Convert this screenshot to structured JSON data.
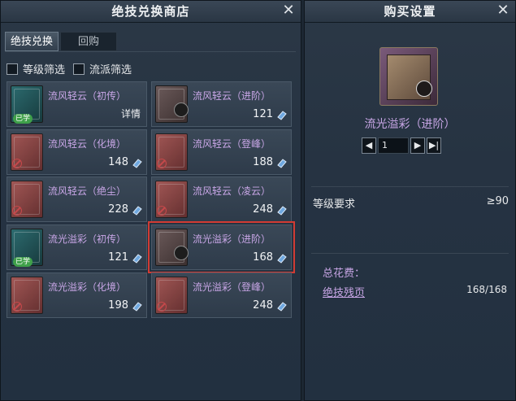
{
  "left_panel": {
    "title": "绝技兑换商店",
    "tabs": [
      {
        "label": "绝技兑换",
        "active": true
      },
      {
        "label": "回购",
        "active": false
      }
    ],
    "filters": [
      {
        "label": "等级筛选",
        "checked": false
      },
      {
        "label": "流派筛选",
        "checked": false
      }
    ],
    "items": [
      {
        "name": "流风轻云（初传）",
        "price": "详情",
        "learned_label": "已学",
        "book_color": "teal",
        "icon": "skill-book-icon"
      },
      {
        "name": "流风轻云（进阶）",
        "price": "121",
        "book_color": "gray",
        "icon": "skill-book-icon"
      },
      {
        "name": "流风轻云（化境）",
        "price": "148",
        "book_color": "red",
        "icon": "skill-book-icon"
      },
      {
        "name": "流风轻云（登峰）",
        "price": "188",
        "book_color": "red",
        "icon": "skill-book-icon"
      },
      {
        "name": "流风轻云（绝尘）",
        "price": "228",
        "book_color": "red",
        "icon": "skill-book-icon"
      },
      {
        "name": "流风轻云（凌云）",
        "price": "248",
        "book_color": "red",
        "icon": "skill-book-icon"
      },
      {
        "name": "流光溢彩（初传）",
        "price": "121",
        "learned_label": "已学",
        "book_color": "teal",
        "icon": "skill-book-icon"
      },
      {
        "name": "流光溢彩（进阶）",
        "price": "168",
        "book_color": "gray",
        "selected": true,
        "icon": "skill-book-icon"
      },
      {
        "name": "流光溢彩（化境）",
        "price": "198",
        "book_color": "red",
        "icon": "skill-book-icon"
      },
      {
        "name": "流光溢彩（登峰）",
        "price": "248",
        "book_color": "red",
        "icon": "skill-book-icon"
      }
    ]
  },
  "right_panel": {
    "title": "购买设置",
    "item_name": "流光溢彩（进阶）",
    "quantity": "1",
    "requirement_label": "等级要求",
    "requirement_value": "≥90",
    "cost_label": "总花费：",
    "cost_item": "绝技残页",
    "cost_value": "168/168"
  },
  "colors": {
    "item_name": "#c8a6e6",
    "selected_outline": "#d23b33",
    "learned_badge": "#3fa04a",
    "currency_icon": "#6fa8e0"
  }
}
